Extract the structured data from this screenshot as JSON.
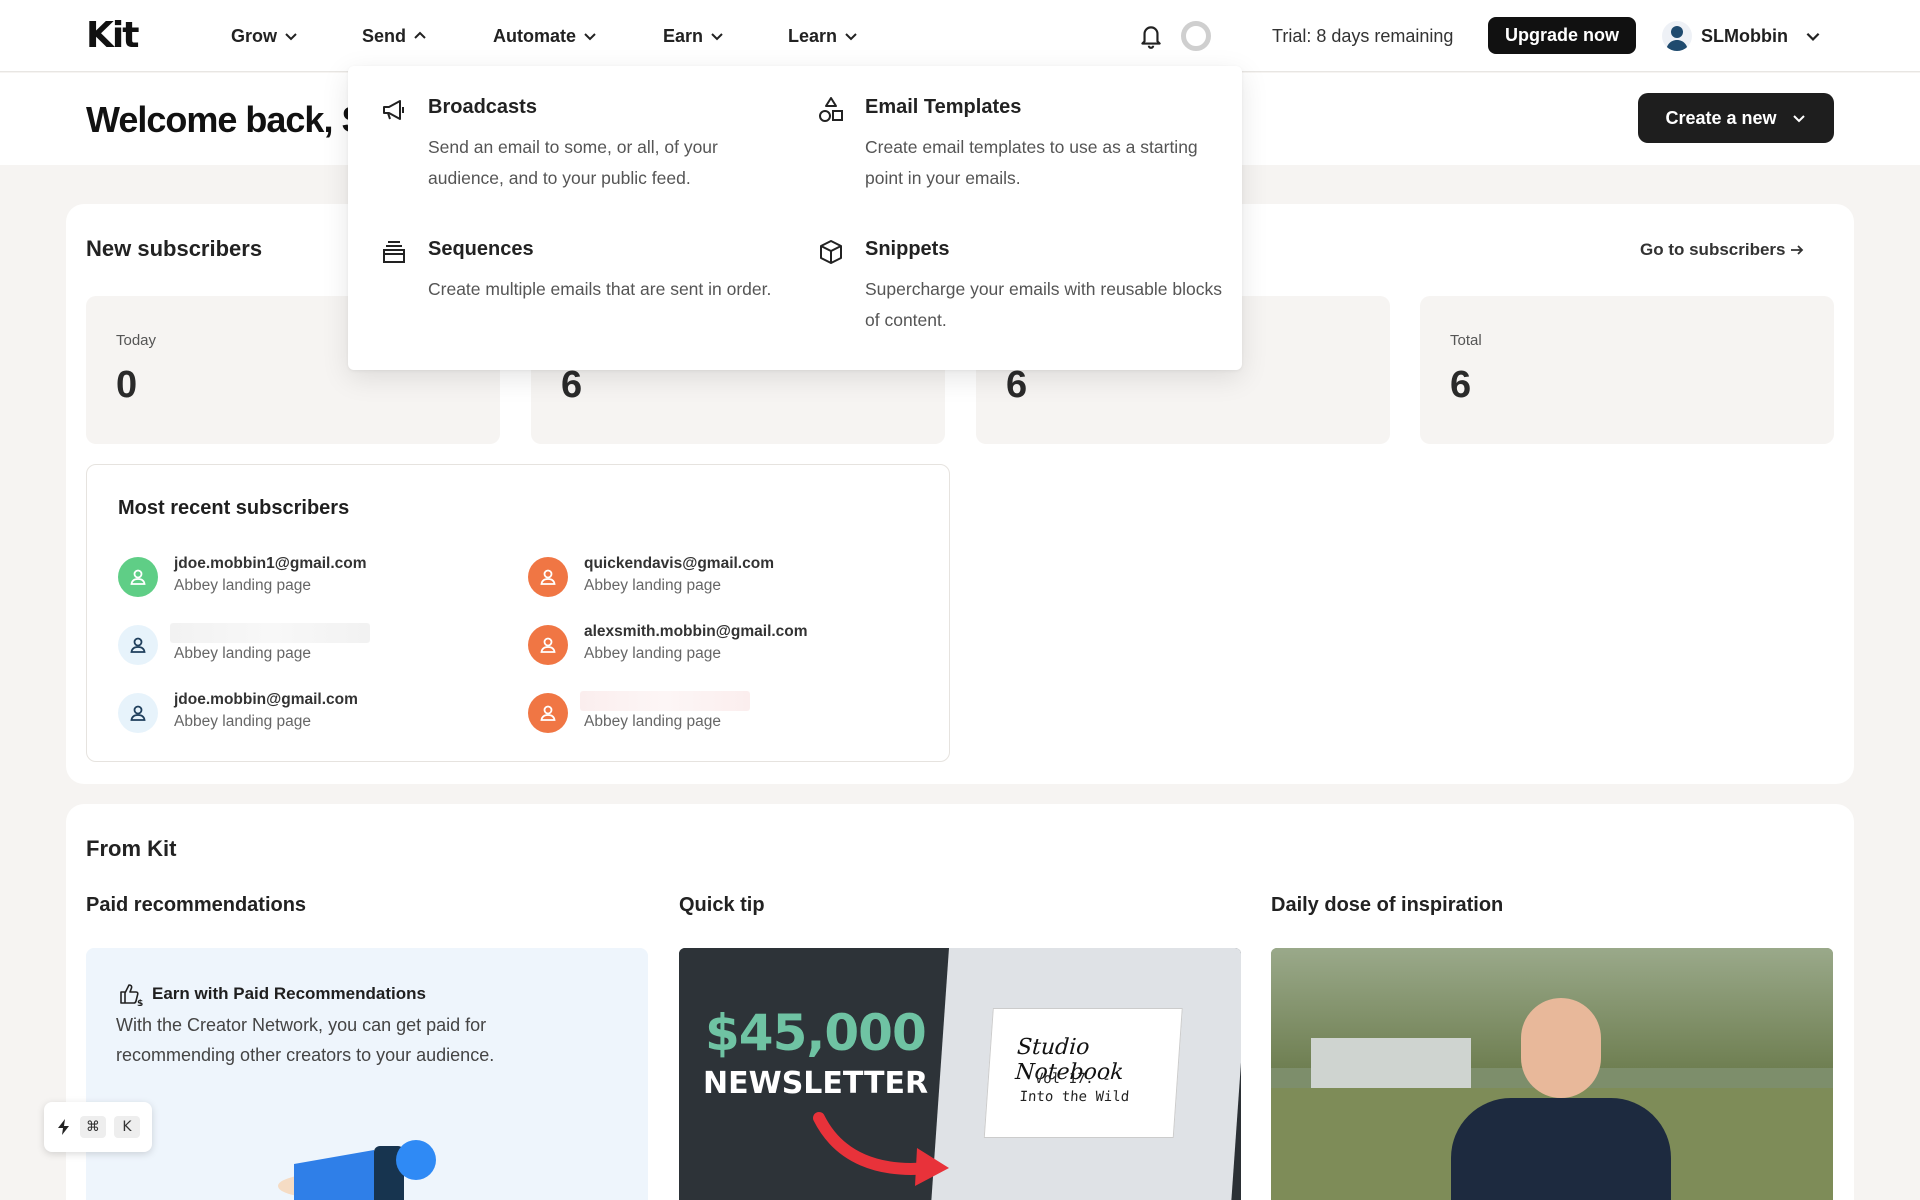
{
  "brand": {
    "logo": "Kit"
  },
  "nav": {
    "items": [
      {
        "label": "Grow",
        "state": "collapsed"
      },
      {
        "label": "Send",
        "state": "expanded"
      },
      {
        "label": "Automate",
        "state": "collapsed"
      },
      {
        "label": "Earn",
        "state": "collapsed"
      },
      {
        "label": "Learn",
        "state": "collapsed"
      }
    ]
  },
  "header": {
    "trial_text": "Trial: 8 days remaining",
    "upgrade_label": "Upgrade now",
    "user_name": "SLMobbin"
  },
  "welcome": {
    "title": "Welcome back, Sa",
    "create_label": "Create a new"
  },
  "send_menu": {
    "items": [
      {
        "title": "Broadcasts",
        "description": "Send an email to some, or all, of your audience, and to your public feed.",
        "icon": "megaphone-icon"
      },
      {
        "title": "Email Templates",
        "description": "Create email templates to use as a starting point in your emails.",
        "icon": "shapes-icon"
      },
      {
        "title": "Sequences",
        "description": "Create multiple emails that are sent in order.",
        "icon": "stack-icon"
      },
      {
        "title": "Snippets",
        "description": "Supercharge your emails with reusable blocks of content.",
        "icon": "cube-icon"
      }
    ]
  },
  "new_subscribers": {
    "title": "New subscribers",
    "go_link": "Go to subscribers",
    "stats": [
      {
        "label": "Today",
        "value": "0"
      },
      {
        "label": "",
        "value": "6"
      },
      {
        "label": "",
        "value": "6"
      },
      {
        "label": "Total",
        "value": "6"
      }
    ]
  },
  "recent_subscribers": {
    "title": "Most recent subscribers",
    "items": [
      {
        "email": "jdoe.mobbin1@gmail.com",
        "source": "Abbey landing page",
        "color": "#5fce86"
      },
      {
        "email": "quickendavis@gmail.com",
        "source": "Abbey landing page",
        "color": "#f07644"
      },
      {
        "email": "",
        "source": "Abbey landing page",
        "color": "#e7f3fb"
      },
      {
        "email": "alexsmith.mobbin@gmail.com",
        "source": "Abbey landing page",
        "color": "#f07644"
      },
      {
        "email": "jdoe.mobbin@gmail.com",
        "source": "Abbey landing page",
        "color": "#e7f3fb"
      },
      {
        "email": "",
        "source": "Abbey landing page",
        "color": "#f07644"
      }
    ]
  },
  "from_kit": {
    "title": "From Kit",
    "paid": {
      "title": "Paid recommendations",
      "card_head": "Earn with Paid Recommendations",
      "card_text": "With the Creator Network, you can get paid for recommending other creators to your audience."
    },
    "tip": {
      "title": "Quick tip",
      "amount": "$45,000",
      "word": "NEWSLETTER",
      "notebook_title": "Studio Notebook",
      "notebook_sub1": "Vol 17. -",
      "notebook_sub2": "Into the Wild"
    },
    "inspiration": {
      "title": "Daily dose of inspiration"
    }
  },
  "shortcut": {
    "key1": "⌘",
    "key2": "K"
  }
}
